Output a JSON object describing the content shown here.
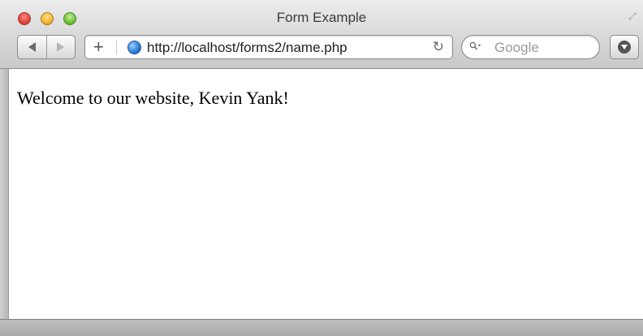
{
  "window": {
    "title": "Form Example",
    "controls": [
      "close",
      "minimize",
      "zoom"
    ],
    "resize_icon": "fullscreen-icon"
  },
  "toolbar": {
    "back_icon": "back-arrow-icon",
    "forward_icon": "forward-arrow-icon",
    "add_icon": "plus-icon",
    "url": "http://localhost/forms2/name.php",
    "reload_icon": "reload-icon",
    "search_placeholder": "Google",
    "search_icon": "magnifier-icon",
    "download_icon": "download-icon"
  },
  "page": {
    "welcome_text": "Welcome to our website, Kevin Yank!"
  },
  "colors": {
    "close": "#e0443a",
    "minimize": "#f5b52e",
    "zoom": "#70c23b",
    "globe": "#2f7fd8"
  }
}
